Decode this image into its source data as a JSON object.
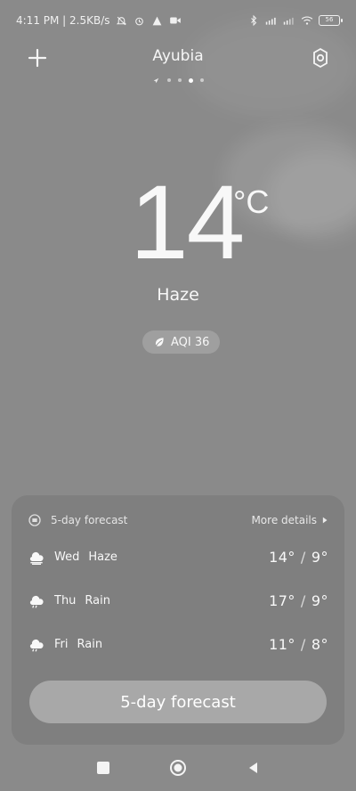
{
  "status_bar": {
    "time_speed": "4:11 PM | 2.5KB/s",
    "battery": "56"
  },
  "header": {
    "city": "Ayubia"
  },
  "current": {
    "temperature": "14",
    "unit": "°C",
    "condition": "Haze",
    "aqi": "AQI 36"
  },
  "forecast_card": {
    "title": "5-day forecast",
    "more": "More details",
    "days": [
      {
        "day": "Wed",
        "condition": "Haze",
        "high": "14°",
        "low": "9°",
        "icon": "haze-icon"
      },
      {
        "day": "Thu",
        "condition": "Rain",
        "high": "17°",
        "low": "9°",
        "icon": "rain-icon"
      },
      {
        "day": "Fri",
        "condition": "Rain",
        "high": "11°",
        "low": "8°",
        "icon": "rain-icon"
      }
    ],
    "button": "5-day forecast"
  }
}
